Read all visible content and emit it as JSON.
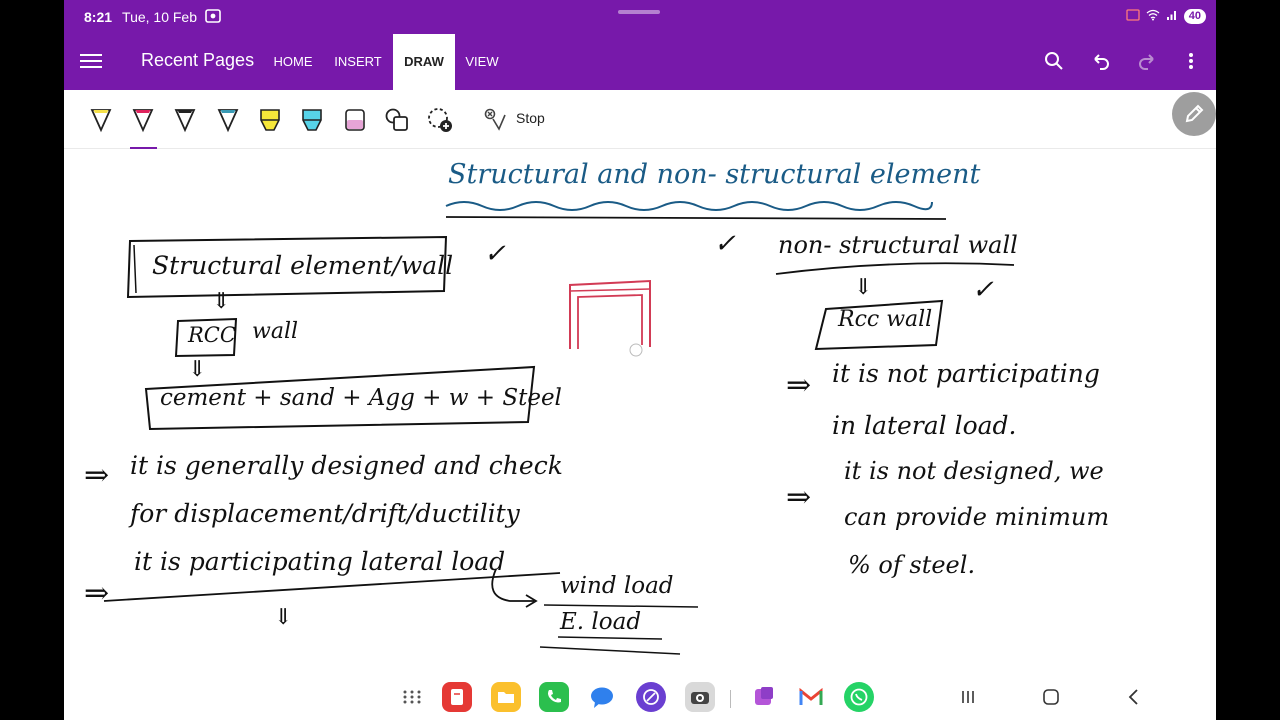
{
  "status": {
    "time": "8:21",
    "date": "Tue, 10 Feb",
    "battery": "40"
  },
  "appbar": {
    "title": "Recent Pages",
    "tabs": [
      "HOME",
      "INSERT",
      "DRAW",
      "VIEW"
    ],
    "active_tab": "DRAW",
    "actions": [
      "search-icon",
      "undo-icon",
      "redo-icon",
      "more-vert-icon"
    ]
  },
  "ribbon": {
    "tools": [
      {
        "name": "pen-yellow-icon",
        "color": "#f5e14a"
      },
      {
        "name": "pen-red-icon",
        "color": "#e0245e"
      },
      {
        "name": "pen-black-icon",
        "color": "#222222"
      },
      {
        "name": "pen-teal-icon",
        "color": "#3a9bb5"
      },
      {
        "name": "highlighter-yellow-icon",
        "color": "#f7e83a"
      },
      {
        "name": "highlighter-cyan-icon",
        "color": "#57d3e8"
      },
      {
        "name": "highlighter-pink-icon",
        "color": "#e6a4d6"
      },
      {
        "name": "shapes-icon"
      },
      {
        "name": "lasso-add-icon"
      }
    ],
    "stop_label": "Stop"
  },
  "note": {
    "heading": "Structural and non- structural element",
    "left_box_title": "Structural element/wall",
    "rcc_box": "RCC",
    "rcc_wall_suffix": "wall",
    "formula": "cement + sand + Agg + w + Steel",
    "left_point_1_line_1": "it is generally designed and check",
    "left_point_1_line_2": "for displacement/drift/ductility",
    "left_point_2": "it is participating lateral load",
    "left_sub_1": "wind load",
    "left_sub_2": "E. load",
    "right_title": "non- structural wall",
    "right_box": "Rcc wall",
    "right_point_1_line_1": "it is not participating",
    "right_point_1_line_2": "in lateral load.",
    "right_point_2_line_1": "it is not designed, we",
    "right_point_2_line_2": "can provide minimum",
    "right_point_2_line_3": "% of steel.",
    "tick_marks": [
      "✓",
      "✓",
      "✓"
    ],
    "arrow": "⇒",
    "down_arrow": "⇓"
  },
  "dock": {
    "apps": [
      "apps-grid-icon",
      "notes-app-icon",
      "files-app-icon",
      "phone-app-icon",
      "messages-app-icon",
      "browser-app-icon",
      "camera-app-icon",
      "gallery-app-icon",
      "gmail-app-icon",
      "whatsapp-app-icon"
    ],
    "nav": [
      "recents-icon",
      "home-icon",
      "back-icon"
    ]
  }
}
